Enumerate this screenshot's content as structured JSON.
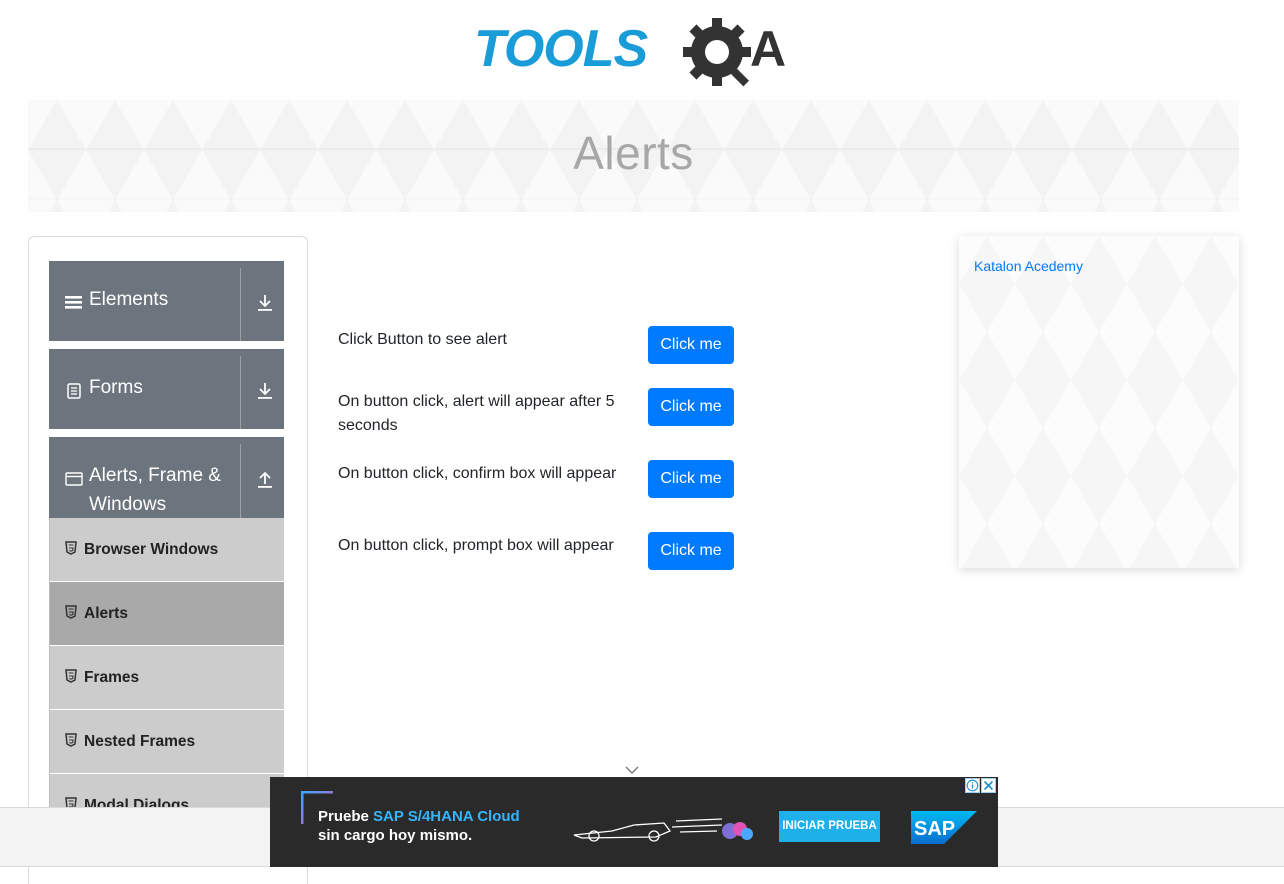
{
  "header": {
    "logo_alt": "TOOLSQA"
  },
  "banner": {
    "title": "Alerts"
  },
  "sidebar": {
    "groups": [
      {
        "label": "Elements",
        "icon": "hamburger-icon",
        "expanded": false
      },
      {
        "label": "Forms",
        "icon": "document-icon",
        "expanded": false
      },
      {
        "label": "Alerts, Frame & Windows",
        "label_line1": "Alerts, Frame &",
        "label_line2": "Windows",
        "icon": "window-icon",
        "expanded": true
      }
    ],
    "items": [
      {
        "label": "Browser Windows",
        "active": false
      },
      {
        "label": "Alerts",
        "active": true
      },
      {
        "label": "Frames",
        "active": false
      },
      {
        "label": "Nested Frames",
        "active": false
      },
      {
        "label": "Modal Dialogs",
        "active": false
      }
    ]
  },
  "alerts": [
    {
      "text": "Click Button to see alert",
      "button": "Click me"
    },
    {
      "text": "On button click, alert will appear after 5 seconds",
      "button": "Click me"
    },
    {
      "text": "On button click, confirm box will appear",
      "button": "Click me"
    },
    {
      "text": "On button click, prompt box will appear",
      "button": "Click me"
    }
  ],
  "ad_card": {
    "link": "Katalon Acedemy"
  },
  "sap_ad": {
    "prefix": "Pruebe ",
    "highlight": "SAP S/4HANA Cloud",
    "line2": "sin cargo hoy mismo.",
    "cta": "INICIAR PRUEBA",
    "brand": "SAP"
  },
  "colors": {
    "primary_button": "#007bff",
    "group_header": "#6c757d",
    "menu_item": "#cccccc",
    "menu_item_active": "#a9a9a9",
    "logo_blue": "#1a9cd8",
    "logo_dark": "#333333"
  }
}
